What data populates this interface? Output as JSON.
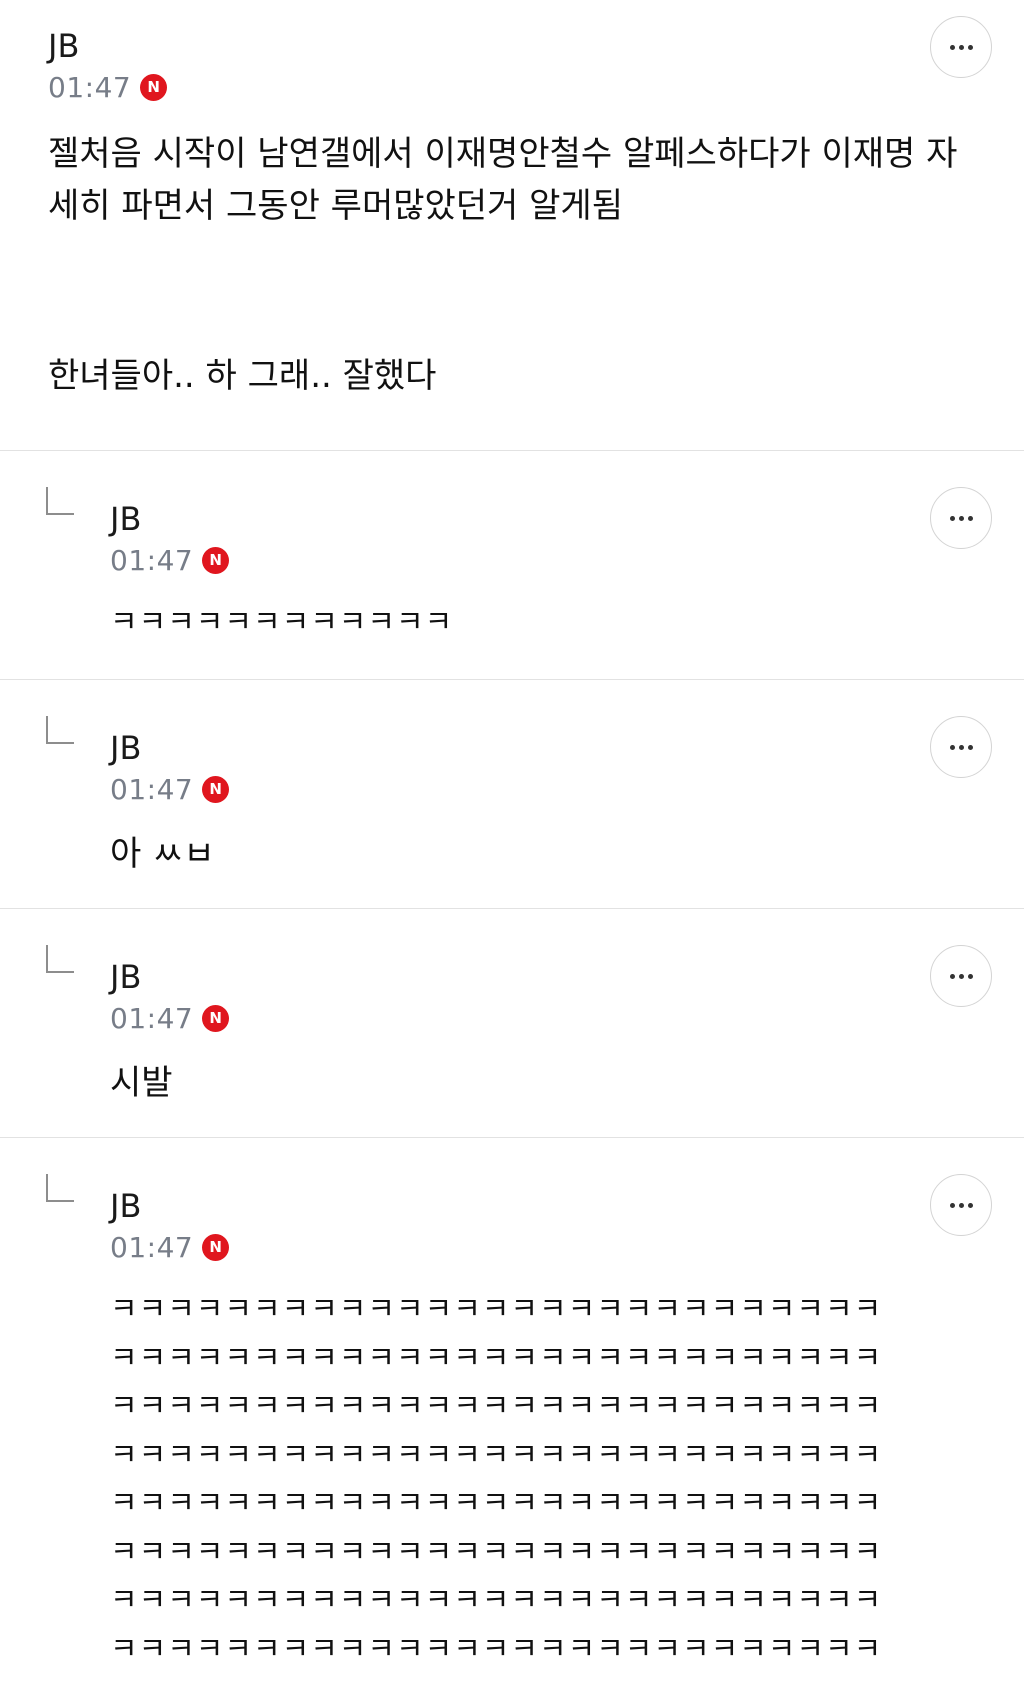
{
  "thread": {
    "main": {
      "author": "JB",
      "time": "01:47",
      "badge": "N",
      "paragraphs": [
        "젤처음 시작이 남연갤에서 이재명안철수 알페스하다가 이재명 자세히 파면서 그동안 루머많았던거 알게됨",
        "한녀들아.. 하 그래.. 잘했다"
      ],
      "more_icon": "more-horizontal-icon"
    },
    "replies": [
      {
        "author": "JB",
        "time": "01:47",
        "badge": "N",
        "text": "ㅋㅋㅋㅋㅋㅋㅋㅋㅋㅋㅋㅋ"
      },
      {
        "author": "JB",
        "time": "01:47",
        "badge": "N",
        "text": "아 ㅆㅂ"
      },
      {
        "author": "JB",
        "time": "01:47",
        "badge": "N",
        "text": "시발"
      },
      {
        "author": "JB",
        "time": "01:47",
        "badge": "N",
        "lines": [
          "ㅋㅋㅋㅋㅋㅋㅋㅋㅋㅋㅋㅋㅋㅋㅋㅋㅋㅋㅋㅋㅋㅋㅋㅋㅋㅋㅋ",
          "ㅋㅋㅋㅋㅋㅋㅋㅋㅋㅋㅋㅋㅋㅋㅋㅋㅋㅋㅋㅋㅋㅋㅋㅋㅋㅋㅋ",
          "ㅋㅋㅋㅋㅋㅋㅋㅋㅋㅋㅋㅋㅋㅋㅋㅋㅋㅋㅋㅋㅋㅋㅋㅋㅋㅋㅋ",
          "ㅋㅋㅋㅋㅋㅋㅋㅋㅋㅋㅋㅋㅋㅋㅋㅋㅋㅋㅋㅋㅋㅋㅋㅋㅋㅋㅋ",
          "ㅋㅋㅋㅋㅋㅋㅋㅋㅋㅋㅋㅋㅋㅋㅋㅋㅋㅋㅋㅋㅋㅋㅋㅋㅋㅋㅋ",
          "ㅋㅋㅋㅋㅋㅋㅋㅋㅋㅋㅋㅋㅋㅋㅋㅋㅋㅋㅋㅋㅋㅋㅋㅋㅋㅋㅋ",
          "ㅋㅋㅋㅋㅋㅋㅋㅋㅋㅋㅋㅋㅋㅋㅋㅋㅋㅋㅋㅋㅋㅋㅋㅋㅋㅋㅋ",
          "ㅋㅋㅋㅋㅋㅋㅋㅋㅋㅋㅋㅋㅋㅋㅋㅋㅋㅋㅋㅋㅋㅋㅋㅋㅋㅋㅋ"
        ]
      }
    ],
    "colors": {
      "badge": "#e0161e",
      "time": "#777d88",
      "divider": "#e2e2e2",
      "reply_mark": "#8d8d8d"
    },
    "icons": {
      "more": "more-horizontal-icon",
      "reply_indicator": "reply-arrow-icon"
    }
  }
}
